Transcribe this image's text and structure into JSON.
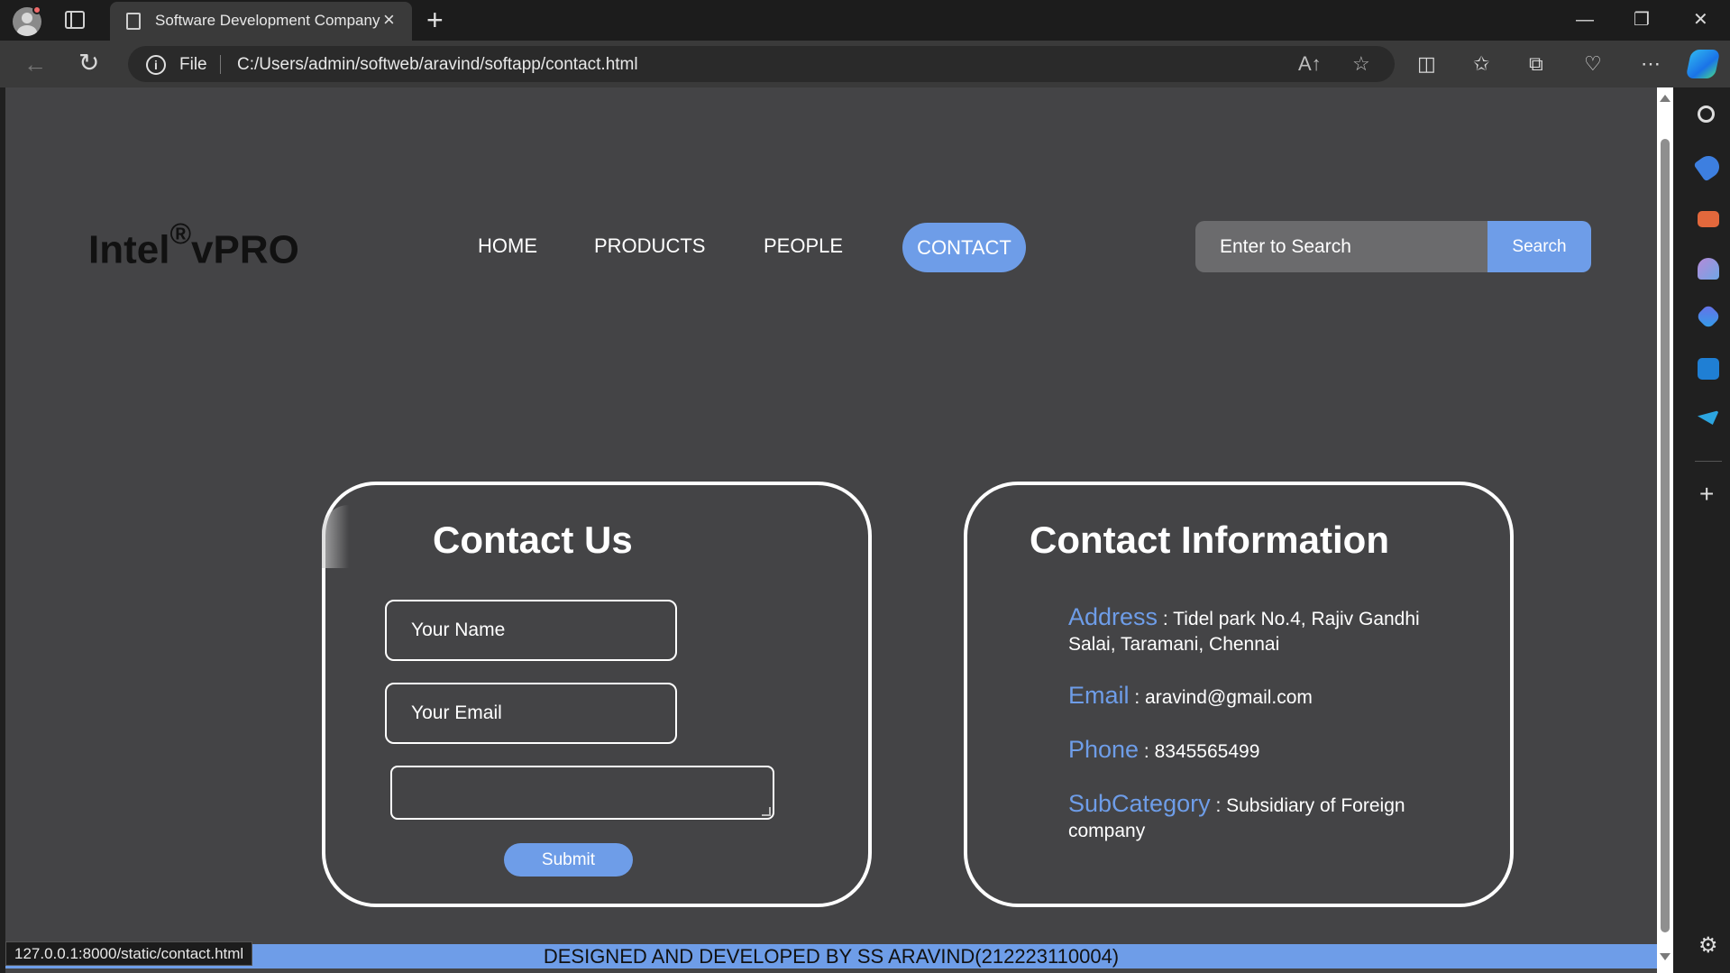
{
  "browser": {
    "tab_title": "Software Development Company",
    "tab_close": "×",
    "new_tab": "+",
    "window_controls": {
      "minimize": "—",
      "maximize": "❐",
      "close": "✕"
    },
    "back": "←",
    "reload": "↻",
    "info_icon": "i",
    "file_label": "File",
    "url": "C:/Users/admin/softweb/aravind/softapp/contact.html",
    "toolbar_icons": [
      "read-aloud-icon",
      "favorite-star-icon",
      "split-screen-icon",
      "favorites-icon",
      "collections-icon",
      "browser-essentials-icon",
      "more-icon",
      "copilot-icon"
    ],
    "status_url": "127.0.0.1:8000/static/contact.html"
  },
  "sidebar": {
    "icons": [
      "search-icon",
      "shopping-tag-icon",
      "tools-icon",
      "games-icon",
      "microsoft-365-icon",
      "outlook-icon",
      "telegram-icon",
      "add-icon",
      "settings-icon"
    ]
  },
  "site": {
    "logo": {
      "brand": "Intel",
      "sup": "®",
      "product": "vPRO"
    },
    "nav": [
      {
        "label": "HOME"
      },
      {
        "label": "PRODUCTS"
      },
      {
        "label": "PEOPLE"
      },
      {
        "label": "CONTACT",
        "active": true
      }
    ],
    "search": {
      "placeholder": "Enter to Search",
      "button": "Search"
    }
  },
  "contact_form": {
    "title": "Contact Us",
    "name_placeholder": "Your Name",
    "email_placeholder": "Your Email",
    "message_value": "",
    "submit": "Submit"
  },
  "contact_info": {
    "title": "Contact Information",
    "address": {
      "key": "Address",
      "value": " : Tidel park No.4, Rajiv Gandhi Salai, Taramani, Chennai"
    },
    "email": {
      "key": "Email",
      "value": " : aravind@gmail.com"
    },
    "phone": {
      "key": "Phone",
      "value": " : 8345565499"
    },
    "subcategory": {
      "key": "SubCategory",
      "value": " : Subsidiary of Foreign company"
    }
  },
  "footer": {
    "text": "DESIGNED AND DEVELOPED BY SS ARAVIND(212223110004)"
  },
  "colors": {
    "accent": "#6e9de8",
    "page_bg": "#444446",
    "text": "#ffffff"
  }
}
